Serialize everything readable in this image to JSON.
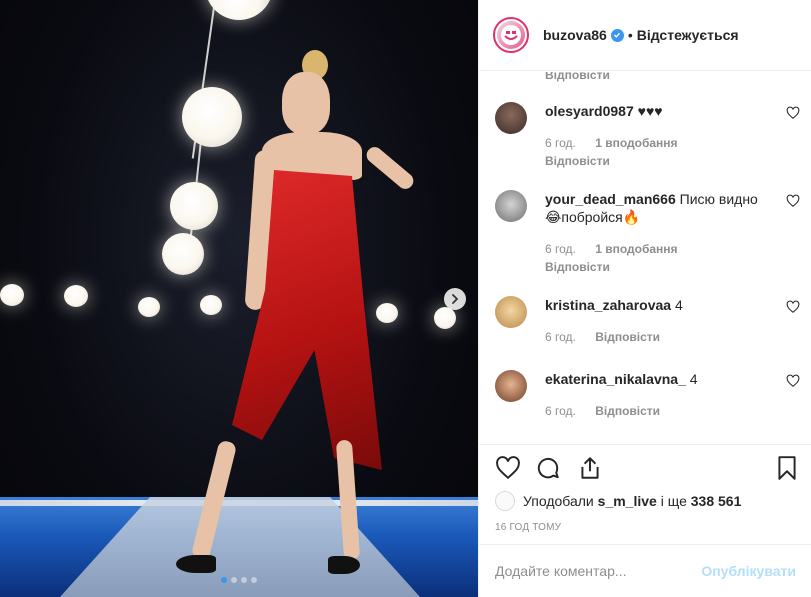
{
  "post": {
    "carousel": {
      "slides_total": 4,
      "active_index": 0
    },
    "icons": {
      "next": "chevron-right-icon"
    }
  },
  "header": {
    "username": "buzova86",
    "verified_icon": "verified-badge-icon",
    "separator": "•",
    "follow_state": "Відстежується"
  },
  "comments": {
    "top_reply": "Відповісти",
    "items": [
      {
        "user": "olesyard0987",
        "text": "♥♥♥",
        "time": "6 год.",
        "likes": "1 вподобання",
        "reply": "Відповісти"
      },
      {
        "user": "your_dead_man666",
        "text": "Писю видно 😂побройся🔥",
        "time": "6 год.",
        "likes": "1 вподобання",
        "reply": "Відповісти"
      },
      {
        "user": "kristina_zaharovaa",
        "text": "4",
        "time": "6 год.",
        "reply": "Відповісти"
      },
      {
        "user": "ekaterina_nikalavna_",
        "text": "4",
        "time": "6 год.",
        "reply": "Відповісти"
      }
    ]
  },
  "actions": {
    "like_icon": "heart-icon",
    "comment_icon": "comment-icon",
    "share_icon": "share-icon",
    "save_icon": "bookmark-icon"
  },
  "likes": {
    "prefix": "Уподобали",
    "user": "s_m_live",
    "middle": "і ще",
    "count": "338 561"
  },
  "timestamp": "16 ГОД ТОМУ",
  "add_comment": {
    "placeholder": "Додайте коментар...",
    "publish_label": "Опублікувати"
  },
  "colors": {
    "accent": "#3897f0",
    "publish_disabled": "#b2dffc",
    "muted": "#8e8e8e"
  }
}
